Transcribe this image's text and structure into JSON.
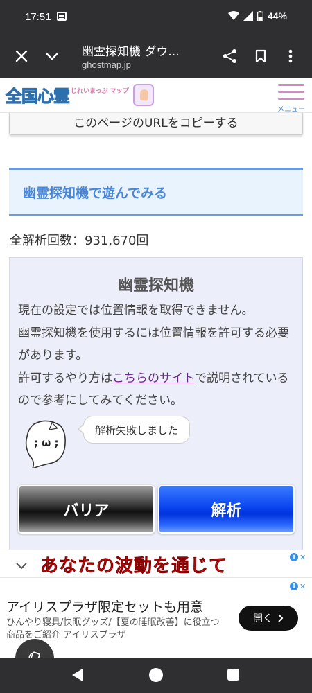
{
  "status": {
    "time": "17:51",
    "battery": "44%"
  },
  "browser": {
    "title": "幽霊探知機 ダウ...",
    "domain": "ghostmap.jp"
  },
  "site": {
    "logo_main": "全国心霊",
    "logo_sub": "じれいまっぷ マップ",
    "menu_label": "メニュー"
  },
  "content": {
    "copy_url_button": "このページのURLをコピーする",
    "section_title": "幽霊探知機で遊んでみる",
    "total_count": "全解析回数：931,670回",
    "panel": {
      "title": "幽霊探知機",
      "msg1": "現在の設定では位置情報を取得できません。",
      "msg2": "幽霊探知機を使用するには位置情報を許可する必要があります。",
      "msg3_before": "許可するやり方は",
      "msg3_link": "こちらのサイト",
      "msg3_after": "で説明されているので参考にしてみてください。",
      "ghost_face": "; ω ;",
      "bubble": "解析失敗しました",
      "barrier_button": "バリア",
      "analyze_button": "解析"
    }
  },
  "ads": {
    "banner_headline": "あなたの波動を通じて",
    "ad_headline": "アイリスプラザ限定セットも用意",
    "ad_desc": "ひんやり寝具/快眠グッズ/【夏の睡眠改善】に役立つ商品をご紹介 アイリスプラザ",
    "ad_open": "開く"
  }
}
